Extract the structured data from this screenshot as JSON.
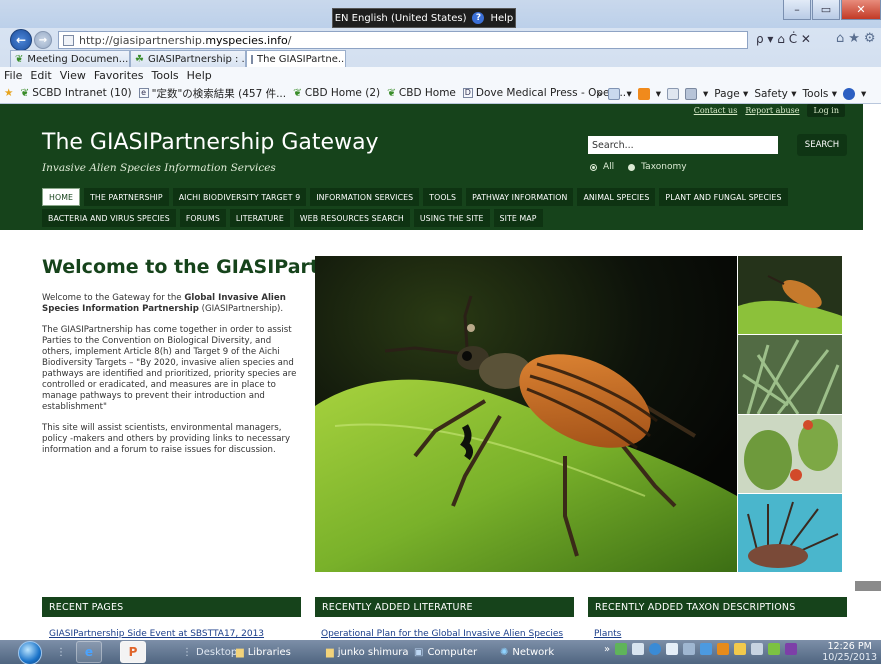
{
  "system_bar": {
    "language": "EN English (United States)",
    "help": "Help"
  },
  "browser": {
    "address": {
      "scheme": "http://giasipartnership.",
      "host": "myspecies.info",
      "path": "/"
    },
    "address_tools": "ρ ▾ ⌂ Ċ ✕",
    "tabs": [
      {
        "label": "Meeting Documen...",
        "active": false
      },
      {
        "label": "GIASIPartnership : ...",
        "active": false
      },
      {
        "label": "The GIASIPartne...",
        "active": true
      }
    ],
    "menu": [
      "File",
      "Edit",
      "View",
      "Favorites",
      "Tools",
      "Help"
    ],
    "favorites": [
      "SCBD Intranet (10)",
      "\"定数\"の検索結果 (457 件...",
      "CBD Home (2)",
      "CBD Home",
      "Dove Medical Press - Open..."
    ],
    "commands": [
      "Page ▾",
      "Safety ▾",
      "Tools ▾"
    ]
  },
  "site": {
    "top_links": {
      "contact": "Contact us",
      "report": "Report abuse",
      "login": "Log in"
    },
    "title": "The GIASIPartnership Gateway",
    "tagline": "Invasive Alien Species Information Services",
    "search": {
      "placeholder": "Search...",
      "button": "SEARCH"
    },
    "scope": {
      "all": "All",
      "taxonomy": "Taxonomy"
    },
    "nav_row1": [
      "HOME",
      "THE PARTNERSHIP",
      "AICHI BIODIVERSITY TARGET 9",
      "INFORMATION SERVICES",
      "TOOLS",
      "PATHWAY INFORMATION",
      "ANIMAL SPECIES",
      "PLANT AND FUNGAL SPECIES"
    ],
    "nav_row2": [
      "BACTERIA AND VIRUS SPECIES",
      "FORUMS",
      "LITERATURE",
      "WEB RESOURCES SEARCH",
      "USING THE SITE",
      "SITE MAP"
    ]
  },
  "welcome": {
    "title": "Welcome to the GIASIPartnership",
    "intro_pre": "Welcome to the Gateway for the ",
    "intro_bold": "Global Invasive Alien Species Information Partnership",
    "intro_post": " (GIASIPartnership).",
    "para2": "The GIASIPartnership has come together in order to assist Parties to the Convention on Biological Diversity, and others, implement Article 8(h) and Target 9 of the Aichi Biodiversity Targets – \"By 2020, invasive alien species and pathways are identified and prioritized, priority species are controlled or eradicated, and measures are in place to manage pathways to prevent their introduction and establishment\"",
    "para3": "This site will assist scientists, environmental managers, policy -makers and others by providing links to necessary information and a forum to raise issues for discussion."
  },
  "panels": [
    {
      "heading": "RECENT PAGES",
      "first_link": "GIASIPartnership Side Event at SBSTTA17, 2013"
    },
    {
      "heading": "RECENTLY ADDED LITERATURE",
      "first_link": "Operational Plan for the Global Invasive Alien Species"
    },
    {
      "heading": "RECENTLY ADDED TAXON DESCRIPTIONS",
      "first_link": "Plants"
    }
  ],
  "taskbar": {
    "desktop": "Desktop",
    "libraries": "Libraries",
    "user": "junko shimura",
    "computer": "Computer",
    "network": "Network",
    "time": "12:26 PM",
    "date": "10/25/2013"
  }
}
